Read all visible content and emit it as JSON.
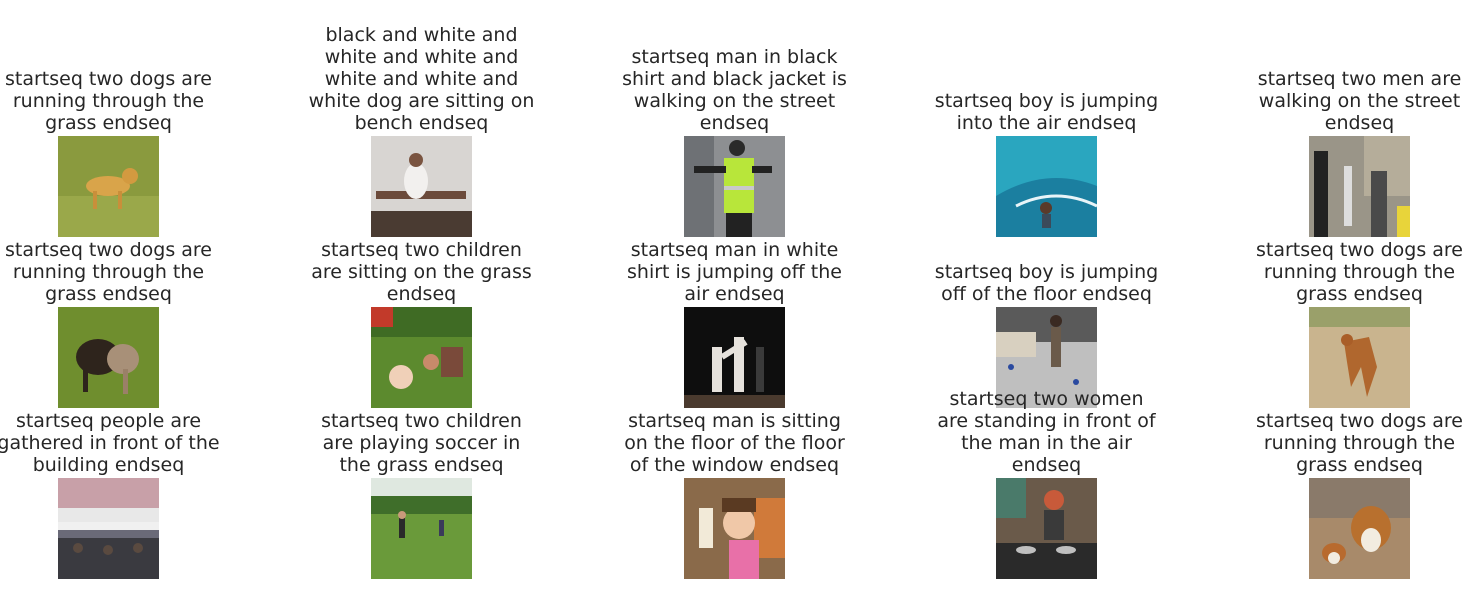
{
  "figure": {
    "cells": [
      {
        "caption": "startseq two dogs are running through the grass endseq",
        "icon": "dog-on-grass-photo"
      },
      {
        "caption": "black and white and white and white and white and white and white dog are sitting on bench endseq",
        "icon": "man-on-bench-photo"
      },
      {
        "caption": "startseq man in black shirt and black jacket is walking on the street endseq",
        "icon": "police-officer-photo"
      },
      {
        "caption": "startseq boy is jumping into the air endseq",
        "icon": "child-on-slide-photo"
      },
      {
        "caption": "startseq two men are walking on the street endseq",
        "icon": "street-people-photo"
      },
      {
        "caption": "startseq two dogs are running through the grass endseq",
        "icon": "dogs-playing-photo"
      },
      {
        "caption": "startseq two children are sitting on the grass endseq",
        "icon": "family-picnic-photo"
      },
      {
        "caption": "startseq man in white shirt is jumping off the air endseq",
        "icon": "martial-arts-photo"
      },
      {
        "caption": "startseq boy is jumping off of the floor endseq",
        "icon": "child-indoor-photo"
      },
      {
        "caption": "startseq two dogs are running through the grass endseq",
        "icon": "dog-on-sand-photo"
      },
      {
        "caption": "startseq people are gathered in front of the building endseq",
        "icon": "crowd-rally-photo"
      },
      {
        "caption": "startseq two children are playing soccer in the grass endseq",
        "icon": "kids-soccer-photo"
      },
      {
        "caption": "startseq man is sitting on the floor of the floor of the window endseq",
        "icon": "girl-with-drink-photo"
      },
      {
        "caption": "startseq two women are standing in front of the man in the air endseq",
        "icon": "dj-woman-photo"
      },
      {
        "caption": "startseq two dogs are running through the grass endseq",
        "icon": "collie-dogs-photo"
      }
    ]
  }
}
